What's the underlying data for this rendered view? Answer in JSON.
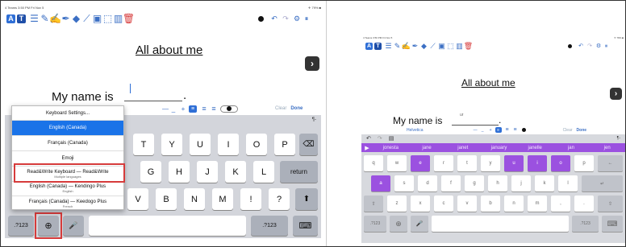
{
  "left": {
    "status_left": "4 Teams  3:50 PM  Fri Nov 5",
    "status_right": "✈ 79% ■",
    "toolbar": {
      "icons": [
        "text-a-icon",
        "text-t-icon",
        "list-icon",
        "pencil-icon",
        "pen-icon",
        "marker-icon",
        "eraser-icon",
        "line-icon",
        "image-icon",
        "crop-icon",
        "audio-icon",
        "trash-icon"
      ],
      "right_icons": [
        "record-icon",
        "undo-icon",
        "redo-icon",
        "settings-icon",
        "more-icon"
      ]
    },
    "page_title": "All about me",
    "name_prompt": "My name is",
    "period": ".",
    "format_bar": {
      "minus": "—",
      "underscore": "_",
      "plus": "+",
      "clear": "Clear",
      "done": "Done",
      "pilcrow": "¶-"
    },
    "keyboard_menu": {
      "items": [
        {
          "label": "Keyboard Settings...",
          "sub": ""
        },
        {
          "label": "English (Canada)",
          "sub": ""
        },
        {
          "label": "Français (Canada)",
          "sub": ""
        },
        {
          "label": "Emoji",
          "sub": ""
        },
        {
          "label": "Read&Write Keyboard — Read&Write",
          "sub": "Multiple languages"
        },
        {
          "label": "English (Canada) — Kendingo Plus",
          "sub": "English"
        },
        {
          "label": "Français (Canada) — Keedogo Plus",
          "sub": "French"
        }
      ],
      "selected": "English (Canada)"
    },
    "keys": {
      "row1": [
        "T",
        "Y",
        "U",
        "I",
        "O",
        "P"
      ],
      "row1_hints": [
        "5",
        "6",
        "7",
        "8",
        "9",
        "0"
      ],
      "row2": [
        "G",
        "H",
        "J",
        "K",
        "L"
      ],
      "row2_hints": [
        "&",
        "*",
        "(",
        ")",
        "'"
      ],
      "row3": [
        "V",
        "B",
        "N",
        "M",
        "!",
        "?"
      ],
      "row3_hints": [
        "=",
        ";",
        ":",
        "'",
        "‘",
        ""
      ],
      "backspace": "⌫",
      "return": "return",
      "shift": "⬆",
      "numbers_left": ".?123",
      "numbers_right": ".?123",
      "globe": "🌐",
      "mic": "🎙",
      "dismiss": "⌨"
    }
  },
  "right": {
    "status_left": "4 Teams  3:50 PM  Fri Nov 5",
    "status_right": "✈ 79% ■",
    "page_title": "All about me",
    "name_prompt": "My name is",
    "typed_hint": "ur",
    "period": ".",
    "font": "Helvetica",
    "format_bar": {
      "minus": "—",
      "underscore": "_",
      "plus": "+",
      "clear": "Clear",
      "done": "Done",
      "pilcrow": "¶-"
    },
    "predictions": [
      "jonesta",
      "jane",
      "janet",
      "january",
      "janelle",
      "jan",
      "jen"
    ],
    "keys": {
      "row1": [
        "q",
        "w",
        "e",
        "r",
        "t",
        "y",
        "u",
        "i",
        "o",
        "p",
        "←"
      ],
      "row2": [
        "a",
        "s",
        "d",
        "f",
        "g",
        "h",
        "j",
        "k",
        "l",
        "↵"
      ],
      "row3": [
        "⇧",
        "z",
        "x",
        "c",
        "v",
        "b",
        "n",
        "m",
        ",",
        ".",
        "⇧"
      ],
      "numbers_left": ".?123",
      "numbers_right": ".?123"
    }
  },
  "colors": {
    "accent": "#2f6fd6",
    "purple": "#9b51e0",
    "highlight": "#d63b3b"
  }
}
